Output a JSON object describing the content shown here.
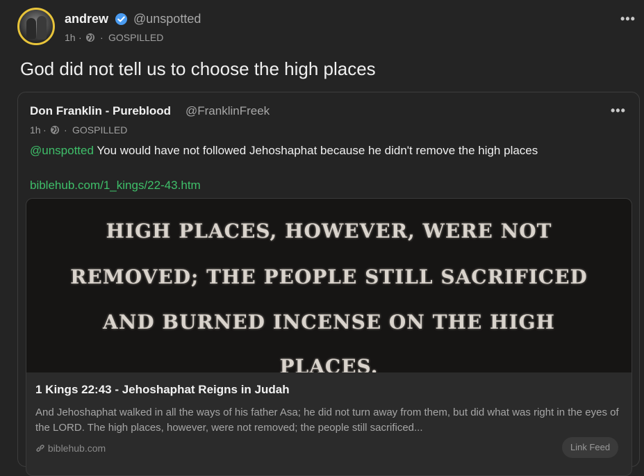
{
  "post": {
    "author_name": "andrew",
    "author_handle": "@unspotted",
    "time": "1h",
    "dot": "·",
    "community": "GOSPILLED",
    "more": "•••",
    "text": "God did not tell us to choose the high places"
  },
  "quoted": {
    "author_name": "Don Franklin - Pureblood",
    "author_handle": "@FranklinFreek",
    "time": "1h",
    "community": "GOSPILLED",
    "more": "•••",
    "mention": "@unspotted",
    "text": " You would have not followed Jehoshaphat because he didn't remove the high places",
    "link": "biblehub.com/1_kings/22-43.htm",
    "card": {
      "image_lines": [
        "HIGH PLACES, HOWEVER, WERE NOT",
        "REMOVED; THE PEOPLE STILL SACRIFICED",
        "AND BURNED INCENSE ON THE HIGH",
        "PLACES."
      ],
      "title": "1 Kings 22:43 - Jehoshaphat Reigns in Judah",
      "description": "And Jehoshaphat walked in all the ways of his father Asa; he did not turn away from them, but did what was right in the eyes of the LORD. The high places, however, were not removed; the people still sacrificed...",
      "source": "biblehub.com",
      "badge": "Link Feed"
    }
  },
  "colors": {
    "background": "#242424",
    "accent_green": "#3fbf6a",
    "verified_blue": "#4a9bf0",
    "avatar_ring": "#e8c43a"
  },
  "icons": {
    "verified": "verified-badge-icon",
    "globe": "globe-icon",
    "more": "more-options-icon",
    "link": "link-icon"
  }
}
